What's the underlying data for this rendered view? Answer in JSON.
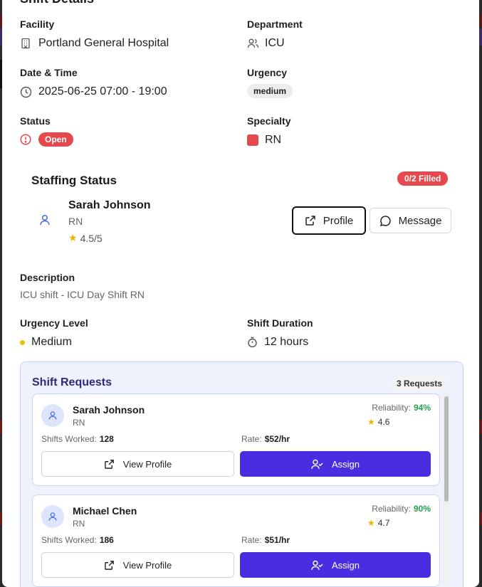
{
  "colors": {
    "accent": "#4a2de0",
    "danger": "#e5484d",
    "success": "#22a34a",
    "star": "#e6b800",
    "urgency_dot": "#e6c400"
  },
  "shift_details": {
    "heading": "Shift Details",
    "facility": {
      "label": "Facility",
      "value": "Portland General Hospital",
      "icon": "building-icon"
    },
    "department": {
      "label": "Department",
      "value": "ICU",
      "icon": "users-icon"
    },
    "datetime": {
      "label": "Date & Time",
      "value": "2025-06-25 07:00 - 19:00",
      "icon": "clock-icon"
    },
    "urgency": {
      "label": "Urgency",
      "value": "medium"
    },
    "status": {
      "label": "Status",
      "value": "Open",
      "icon": "alert-circle-icon"
    },
    "specialty": {
      "label": "Specialty",
      "value": "RN"
    }
  },
  "staffing": {
    "title": "Staffing Status",
    "filled_badge": "0/2 Filled",
    "staff": {
      "name": "Sarah Johnson",
      "role": "RN",
      "rating": "4.5/5"
    },
    "profile_button": "Profile",
    "message_button": "Message"
  },
  "description": {
    "label": "Description",
    "value": "ICU shift - ICU Day Shift RN"
  },
  "urgency_level": {
    "label": "Urgency Level",
    "value": "Medium"
  },
  "shift_duration": {
    "label": "Shift Duration",
    "value": "12 hours"
  },
  "shift_requests": {
    "title": "Shift Requests",
    "count_badge": "3 Requests",
    "items": [
      {
        "name": "Sarah Johnson",
        "role": "RN",
        "reliability_label": "Reliability:",
        "reliability": "94%",
        "rating": "4.6",
        "shifts_label": "Shifts Worked:",
        "shifts": "128",
        "rate_label": "Rate:",
        "rate": "$52/hr",
        "view_label": "View Profile",
        "assign_label": "Assign"
      },
      {
        "name": "Michael Chen",
        "role": "RN",
        "reliability_label": "Reliability:",
        "reliability": "90%",
        "rating": "4.7",
        "shifts_label": "Shifts Worked:",
        "shifts": "186",
        "rate_label": "Rate:",
        "rate": "$51/hr",
        "view_label": "View Profile",
        "assign_label": "Assign"
      }
    ]
  }
}
